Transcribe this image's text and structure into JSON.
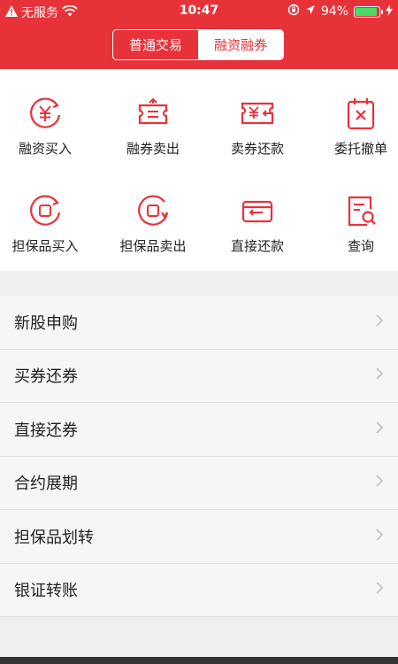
{
  "status": {
    "carrier": "无服务",
    "time": "10:47",
    "battery": "94%",
    "battery_level": 0.94
  },
  "segment": {
    "tabs": [
      "普通交易",
      "融资融券"
    ],
    "active_index": 1
  },
  "actions": [
    {
      "label": "融资买入",
      "icon": "finance-buy-icon"
    },
    {
      "label": "融券卖出",
      "icon": "securities-sell-icon"
    },
    {
      "label": "卖券还款",
      "icon": "sell-repay-icon"
    },
    {
      "label": "委托撤单",
      "icon": "cancel-order-icon"
    },
    {
      "label": "担保品买入",
      "icon": "collateral-buy-icon"
    },
    {
      "label": "担保品卖出",
      "icon": "collateral-sell-icon"
    },
    {
      "label": "直接还款",
      "icon": "direct-repay-icon"
    },
    {
      "label": "查询",
      "icon": "query-icon"
    }
  ],
  "menu": [
    {
      "label": "新股申购"
    },
    {
      "label": "买券还券"
    },
    {
      "label": "直接还券"
    },
    {
      "label": "合约展期"
    },
    {
      "label": "担保品划转"
    },
    {
      "label": "银证转账"
    }
  ],
  "colors": {
    "accent": "#e8323a",
    "battery": "#4cd964"
  }
}
